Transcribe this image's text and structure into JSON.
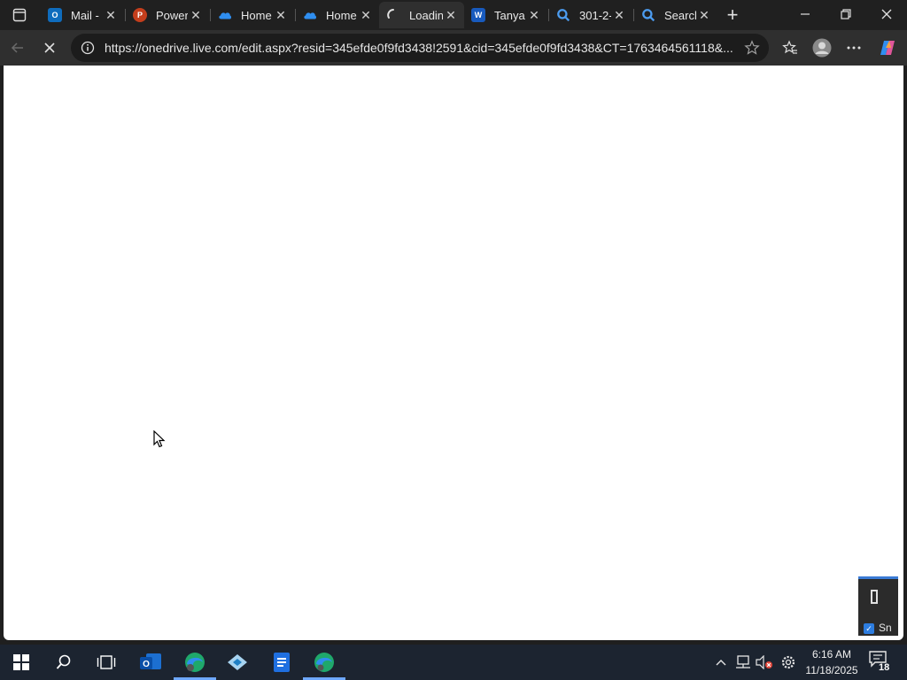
{
  "browser": {
    "tabs": [
      {
        "label": "Mail -",
        "icon": "outlook-icon",
        "color": "#0f6cbd",
        "active": false
      },
      {
        "label": "Powerl",
        "icon": "powerpoint-icon",
        "color": "#c43e1c",
        "active": false
      },
      {
        "label": "Home",
        "icon": "onedrive-icon",
        "color": "#0f6cbd",
        "active": false
      },
      {
        "label": "Home",
        "icon": "onedrive-icon",
        "color": "#0f6cbd",
        "active": false
      },
      {
        "label": "Loadin",
        "icon": "loading-spinner-icon",
        "color": "#e0e0e0",
        "active": true
      },
      {
        "label": "Tanya",
        "icon": "word-icon",
        "color": "#185abd",
        "active": false
      },
      {
        "label": "301-2-",
        "icon": "search-icon",
        "color": "#4c9cf0",
        "active": false
      },
      {
        "label": "Search",
        "icon": "search-icon",
        "color": "#4c9cf0",
        "active": false
      }
    ],
    "new_tab_label": "+",
    "url": "https://onedrive.live.com/edit.aspx?resid=345efde0f9fd3438!2591&cid=345efde0f9fd3438&CT=1763464561118&..."
  },
  "side_panel": {
    "label": "Sn"
  },
  "taskbar": {
    "time": "6:16 AM",
    "date": "11/18/2025",
    "notification_count": "18"
  },
  "colors": {
    "accent": "#3a7bd5",
    "content_bg": "#ffffff",
    "chrome_bg": "#202020"
  }
}
